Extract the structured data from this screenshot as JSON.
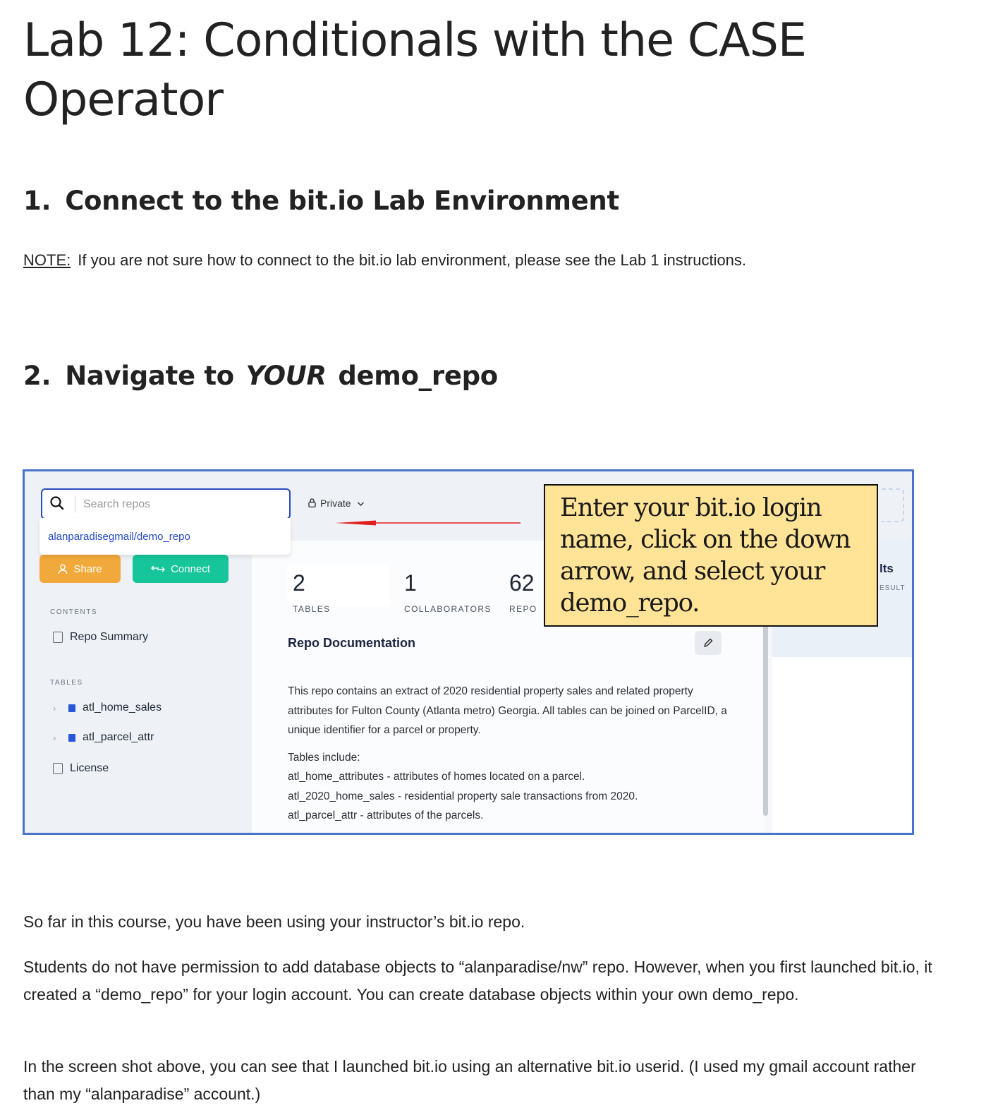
{
  "title": "Lab 12: Conditionals with the CASE Operator",
  "section1": {
    "number": "1.",
    "heading": "Connect to the bit.io Lab Environment"
  },
  "note": {
    "label": "NOTE:",
    "text": "If you are not sure how to connect to the bit.io lab environment, please see the Lab 1 instructions."
  },
  "section2": {
    "number": "2.",
    "heading_prefix": "Navigate to",
    "heading_emphasis": "YOUR",
    "heading_suffix": "demo_repo"
  },
  "screenshot": {
    "search_placeholder": "Search repos",
    "search_result": "alanparadisegmail/demo_repo",
    "private_label": "Private",
    "share_label": "Share",
    "connect_label": "Connect",
    "contents_heading": "CONTENTS",
    "repo_summary": "Repo Summary",
    "tables_heading": "TABLES",
    "tables": [
      "atl_home_sales",
      "atl_parcel_attr"
    ],
    "license": "License",
    "stats": [
      {
        "value": "2",
        "label": "TABLES"
      },
      {
        "value": "1",
        "label": "COLLABORATORS"
      },
      {
        "value": "62",
        "label": "REPO"
      }
    ],
    "doc_title": "Repo Documentation",
    "doc_paragraph": "This repo contains an extract of 2020 residential property sales and related property attributes for Fulton County (Atlanta metro) Georgia. All tables can be joined on ParcelID, a unique identifier for a parcel or property.",
    "doc_tables_intro": "Tables include:",
    "doc_table_lines": [
      "atl_home_attributes - attributes of homes located on a parcel.",
      "atl_2020_home_sales - residential property sale transactions from 2020.",
      "atl_parcel_attr - attributes of the parcels."
    ],
    "right_tab_label": "lts",
    "right_tab_sub": "ESULT",
    "callout": "Enter your bit.io login name, click on the down arrow, and select your demo_repo.",
    "colors": {
      "frame": "#4a74c9",
      "share": "#f2a93b",
      "connect": "#16c59a",
      "callout": "#ffe396",
      "link": "#2348c7",
      "arrow": "#e02020"
    },
    "icons": [
      "search-icon",
      "lock-icon",
      "chevron-down-icon",
      "user-icon",
      "connect-arrows-icon",
      "document-icon",
      "table-icon",
      "chevron-right-icon",
      "pencil-icon"
    ]
  },
  "paragraphs": [
    "So far in this course, you have been using your instructor’s bit.io repo.",
    "Students do not have permission to add database objects to “alanparadise/nw” repo.  However, when you first launched bit.io, it created a “demo_repo” for your login account.  You can create database objects within your own demo_repo.",
    "In the screen shot above, you can see that I launched bit.io using an alternative bit.io userid.  (I used my gmail account rather than my “alanparadise” account.)"
  ]
}
